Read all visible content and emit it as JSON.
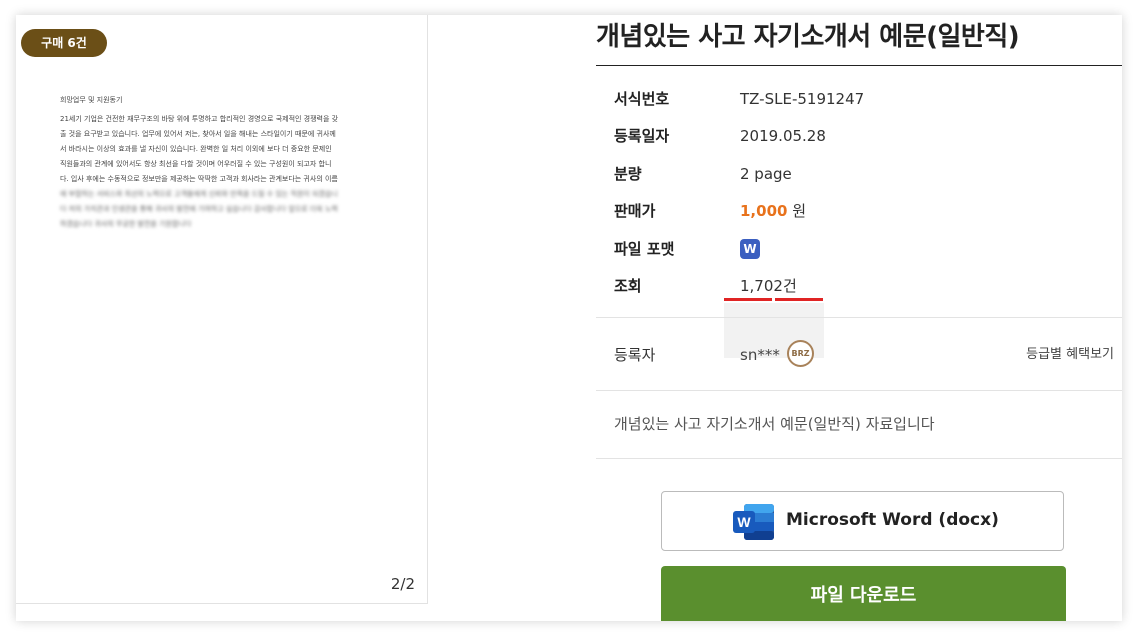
{
  "preview": {
    "badge": "구매 6건",
    "doc_heading": "희망업무 및 지원동기",
    "doc_lines": [
      "21세기 기업은 건전한 재무구조의 바탕 위에 투명하고 합리적인 경영으로 국제적인 경쟁력을 갖",
      "출 것을 요구받고 있습니다. 업무에 있어서 저는, 찾아서 일을 해내는 스타일이기 때문에 귀사께",
      "서 바라시는 이상의 효과를 낼 자신이 있습니다. 완벽한 일 처리 이외에 보다 더 중요한 문제인",
      "직원들과의 관계에 있어서도 항상 최선을 다할 것이며 어우러질 수 있는 구성원이 되고자 합니",
      "다. 입사 후에는 수동적으로 정보만을 제공하는 딱딱한 고객과 회사라는 관계보다는 귀사의 이름"
    ],
    "doc_lines_blurred": [
      "에 부합하는 서비스와 최선의 노력으로 고객들에게 신뢰와 만족을 드릴 수 있는 직원이 되겠습니",
      "다 저의 가치관과 인생관을 통해 귀사의 발전에 기여하고 싶습니다 감사합니다 앞으로 더욱 노력",
      "하겠습니다 귀사의 무궁한 발전을 기원합니다"
    ],
    "page_indicator": "2/2"
  },
  "product": {
    "title": "개념있는 사고 자기소개서 예문(일반직)",
    "details": {
      "code_label": "서식번호",
      "code_value": "TZ-SLE-5191247",
      "date_label": "등록일자",
      "date_value": "2019.05.28",
      "pages_label": "분량",
      "pages_value": "2 page",
      "price_label": "판매가",
      "price_value": "1,000",
      "price_unit": " 원",
      "format_label": "파일 포맷",
      "format_icon_letter": "W",
      "views_label": "조회",
      "views_value": "1,702건"
    },
    "registrant": {
      "label": "등록자",
      "value": "sn***",
      "grade": "BRZ",
      "benefit_link": "등급별 혜택보기"
    },
    "description": "개념있는 사고 자기소개서 예문(일반직) 자료입니다",
    "format_button": {
      "icon_letter": "W",
      "label": "Microsoft Word (docx)"
    },
    "download_button": "파일 다운로드"
  },
  "colors": {
    "badge_bg": "#6b4f17",
    "price": "#e8721c",
    "download_bg": "#5a8f2e",
    "word_blue": "#3b5fc0"
  }
}
